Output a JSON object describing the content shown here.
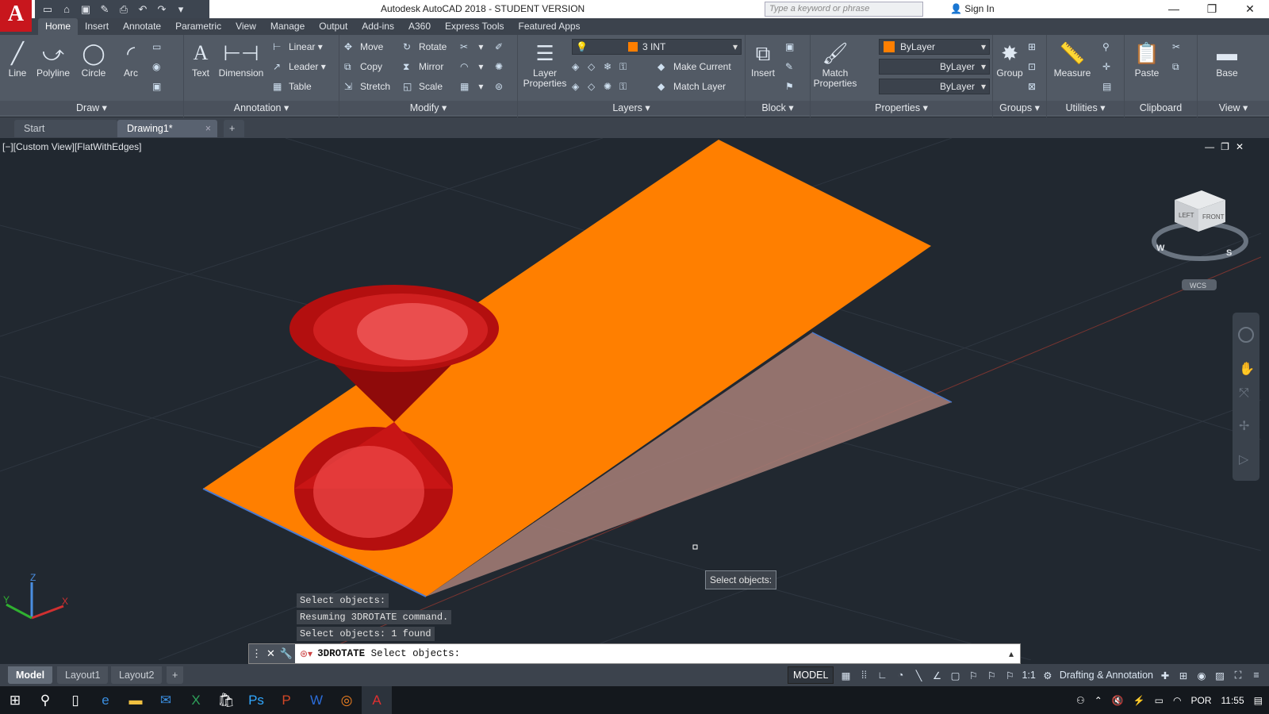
{
  "title_bar": {
    "app_logo": "A",
    "title": "Autodesk AutoCAD 2018 - STUDENT VERSION",
    "search_placeholder": "Type a keyword or phrase",
    "sign_in": "Sign In",
    "quick_access": [
      "new-icon",
      "open-icon",
      "save-icon",
      "saveas-icon",
      "print-icon",
      "undo-icon",
      "redo-icon",
      "more-icon"
    ]
  },
  "ribbon_tabs": [
    "Home",
    "Insert",
    "Annotate",
    "Parametric",
    "View",
    "Manage",
    "Output",
    "Add-ins",
    "A360",
    "Express Tools",
    "Featured Apps"
  ],
  "panels": {
    "draw": {
      "title": "Draw",
      "line": "Line",
      "polyline": "Polyline",
      "circle": "Circle",
      "arc": "Arc"
    },
    "annotation": {
      "title": "Annotation",
      "text": "Text",
      "dimension": "Dimension",
      "linear": "Linear",
      "leader": "Leader",
      "table": "Table"
    },
    "modify": {
      "title": "Modify",
      "move": "Move",
      "rotate": "Rotate",
      "copy": "Copy",
      "mirror": "Mirror",
      "stretch": "Stretch",
      "scale": "Scale"
    },
    "layers": {
      "title": "Layers",
      "layer_properties_1": "Layer",
      "layer_properties_2": "Properties",
      "current_layer": "3 INT",
      "make_current": "Make Current",
      "match_layer": "Match Layer"
    },
    "block": {
      "title": "Block",
      "insert": "Insert"
    },
    "properties": {
      "title": "Properties",
      "match_1": "Match",
      "match_2": "Properties",
      "color": "ByLayer",
      "linetype": "ByLayer",
      "lineweight": "ByLayer",
      "color_swatch": "#ff7f00"
    },
    "groups": {
      "title": "Groups",
      "group": "Group"
    },
    "utilities": {
      "title": "Utilities",
      "measure": "Measure"
    },
    "clipboard": {
      "title": "Clipboard",
      "paste": "Paste"
    },
    "view": {
      "title": "View",
      "base": "Base"
    }
  },
  "doc_tabs": {
    "start": "Start",
    "drawing": "Drawing1*",
    "close": "×",
    "add": "+"
  },
  "viewport": {
    "label": "[−][Custom View][FlatWithEdges]",
    "viewcube_left": "LEFT",
    "viewcube_front": "FRONT",
    "compass_w": "W",
    "compass_s": "S",
    "wcs": "WCS",
    "axis_x": "X",
    "axis_y": "Y",
    "axis_z": "Z"
  },
  "command_history": [
    "Select objects:",
    "Resuming 3DROTATE command.",
    "Select objects: 1 found"
  ],
  "tooltip": "Select objects:",
  "command_line": {
    "command": "3DROTATE",
    "prompt": "Select objects:"
  },
  "layout_tabs": [
    "Model",
    "Layout1",
    "Layout2"
  ],
  "status": {
    "model": "MODEL",
    "scale": "1:1",
    "workspace": "Drafting & Annotation"
  },
  "tray": {
    "language": "POR",
    "time": "11:55"
  },
  "colors": {
    "plane": "#ff7f00",
    "cone": "#cc1010",
    "ghost": "#a07a74",
    "background": "#212830"
  }
}
